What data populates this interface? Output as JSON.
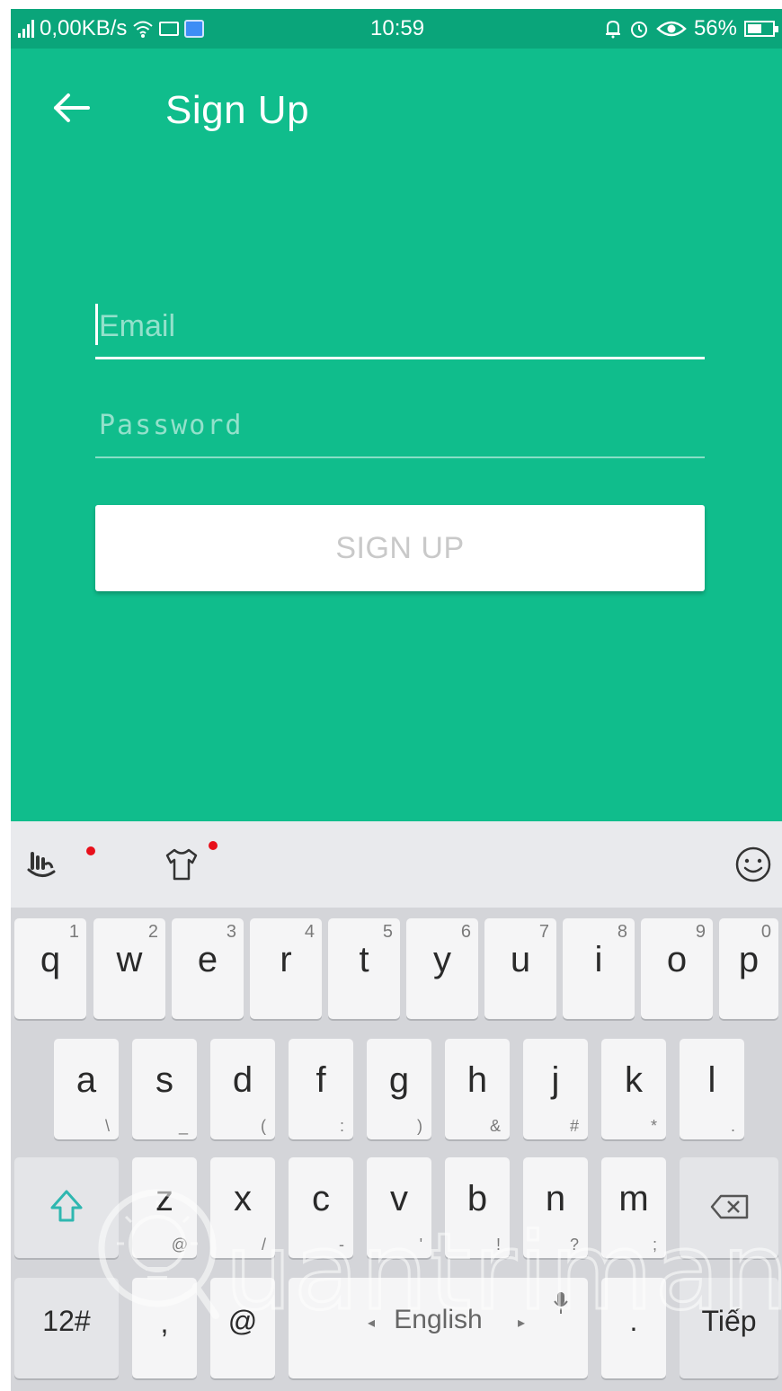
{
  "status_bar": {
    "net_speed": "0,00KB/s",
    "time": "10:59",
    "battery": "56%",
    "icons": [
      "signal-icon",
      "wifi-icon",
      "mail-icon",
      "app-notification-icon",
      "bell-icon",
      "alarm-icon",
      "eye-icon",
      "battery-icon"
    ]
  },
  "header": {
    "back_icon": "arrow-left-icon",
    "title": "Sign Up"
  },
  "form": {
    "email_placeholder": "Email",
    "password_placeholder": "Password",
    "submit_label": "SIGN UP"
  },
  "theme": {
    "primary": "#10bd8c",
    "status_bar": "#0aa57a",
    "button_text": "#c9c9c9",
    "notification_dot": "#e8101b"
  },
  "keyboard": {
    "toolbar_icons": [
      "gesture-icon",
      "theme-shirt-icon",
      "emoji-icon"
    ],
    "row1": [
      {
        "ch": "q",
        "hint": "1"
      },
      {
        "ch": "w",
        "hint": "2"
      },
      {
        "ch": "e",
        "hint": "3"
      },
      {
        "ch": "r",
        "hint": "4"
      },
      {
        "ch": "t",
        "hint": "5"
      },
      {
        "ch": "y",
        "hint": "6"
      },
      {
        "ch": "u",
        "hint": "7"
      },
      {
        "ch": "i",
        "hint": "8"
      },
      {
        "ch": "o",
        "hint": "9"
      },
      {
        "ch": "p",
        "hint": "0"
      }
    ],
    "row2": [
      {
        "ch": "a",
        "hint": "\\"
      },
      {
        "ch": "s",
        "hint": "_"
      },
      {
        "ch": "d",
        "hint": "("
      },
      {
        "ch": "f",
        "hint": ":"
      },
      {
        "ch": "g",
        "hint": ")"
      },
      {
        "ch": "h",
        "hint": "&"
      },
      {
        "ch": "j",
        "hint": "#"
      },
      {
        "ch": "k",
        "hint": "*"
      },
      {
        "ch": "l",
        "hint": "."
      }
    ],
    "row3": [
      {
        "ch": "z",
        "hint": "@"
      },
      {
        "ch": "x",
        "hint": "/"
      },
      {
        "ch": "c",
        "hint": "-"
      },
      {
        "ch": "v",
        "hint": "'"
      },
      {
        "ch": "b",
        "hint": "!"
      },
      {
        "ch": "n",
        "hint": "?"
      },
      {
        "ch": "m",
        "hint": ";"
      }
    ],
    "shift_icon": "shift-icon",
    "backspace_icon": "backspace-icon",
    "row4": {
      "numbers": "12#",
      "comma": ",",
      "at": "@",
      "space": "English",
      "period": ".",
      "enter": "Tiếp"
    }
  },
  "watermark": {
    "text": "uantrimang"
  }
}
